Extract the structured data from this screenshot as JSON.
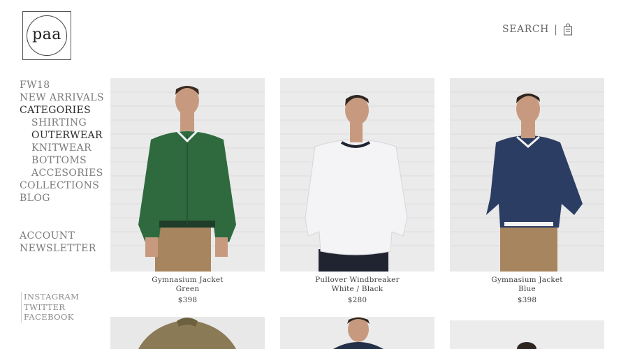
{
  "brand": {
    "logo_text": "paa"
  },
  "header": {
    "search_label": "SEARCH",
    "separator": "|",
    "bag_icon": "shopping-bag-icon"
  },
  "nav": {
    "items": [
      {
        "label": "FW18"
      },
      {
        "label": "NEW ARRIVALS"
      },
      {
        "label": "CATEGORIES"
      },
      {
        "label": "SHIRTING"
      },
      {
        "label": "OUTERWEAR"
      },
      {
        "label": "KNITWEAR"
      },
      {
        "label": "BOTTOMS"
      },
      {
        "label": "ACCESORIES"
      },
      {
        "label": "COLLECTIONS"
      },
      {
        "label": "BLOG"
      }
    ],
    "secondary": [
      {
        "label": "ACCOUNT"
      },
      {
        "label": "NEWSLETTER"
      }
    ],
    "social": [
      {
        "label": "INSTAGRAM"
      },
      {
        "label": "TWITTER"
      },
      {
        "label": "FACEBOOK"
      }
    ]
  },
  "products": [
    {
      "name": "Gymnasium Jacket",
      "variant": "Green",
      "price": "$398",
      "color": "#2f6a3f"
    },
    {
      "name": "Pullover Windbreaker",
      "variant": "White / Black",
      "price": "$280",
      "color": "#f4f4f6"
    },
    {
      "name": "Gymnasium Jacket",
      "variant": "Blue",
      "price": "$398",
      "color": "#2c3d63"
    }
  ],
  "colors": {
    "wall": "#e9e9e9",
    "khaki": "#a7865f",
    "skin": "#c79a80",
    "dark": "#1f2430",
    "olive": "#8a7a55"
  }
}
